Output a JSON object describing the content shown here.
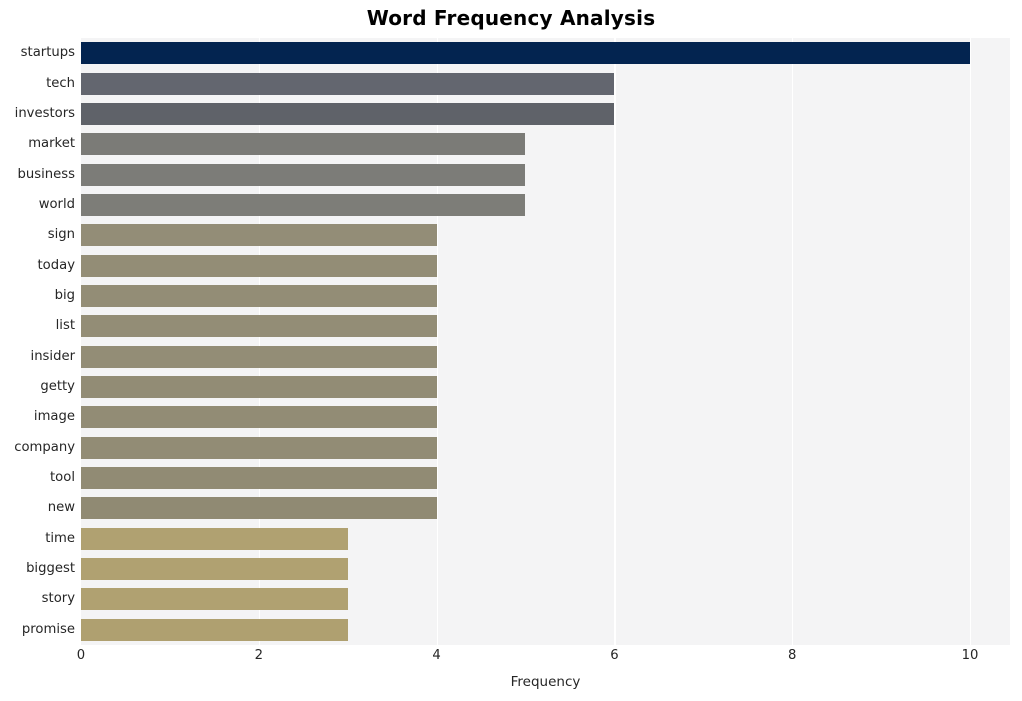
{
  "chart_data": {
    "type": "bar",
    "orientation": "horizontal",
    "title": "Word Frequency Analysis",
    "xlabel": "Frequency",
    "ylabel": "",
    "xlim": [
      0,
      10.45
    ],
    "xticks": [
      0,
      2,
      4,
      6,
      8,
      10
    ],
    "xtick_labels": [
      "0",
      "2",
      "4",
      "6",
      "8",
      "10"
    ],
    "grid": "vertical-white",
    "legend": "none",
    "categories": [
      "startups",
      "tech",
      "investors",
      "market",
      "business",
      "world",
      "sign",
      "today",
      "big",
      "list",
      "insider",
      "getty",
      "image",
      "company",
      "tool",
      "new",
      "time",
      "biggest",
      "story",
      "promise"
    ],
    "values": [
      10,
      6,
      6,
      5,
      5,
      5,
      4,
      4,
      4,
      4,
      4,
      4,
      4,
      4,
      4,
      4,
      3,
      3,
      3,
      3
    ],
    "bar_colors": [
      "#032450",
      "#63666f",
      "#5f6269",
      "#7b7b77",
      "#7c7c78",
      "#7d7d78",
      "#938d77",
      "#938d76",
      "#938d76",
      "#938d76",
      "#938d76",
      "#928c75",
      "#928c75",
      "#928c75",
      "#918b74",
      "#908a73",
      "#b0a171",
      "#b0a171",
      "#b0a171",
      "#afa070"
    ],
    "plot_background": "#f4f4f5",
    "gridline_color": "#ffffff",
    "text_color": "#262626",
    "title_color": "#000000"
  }
}
